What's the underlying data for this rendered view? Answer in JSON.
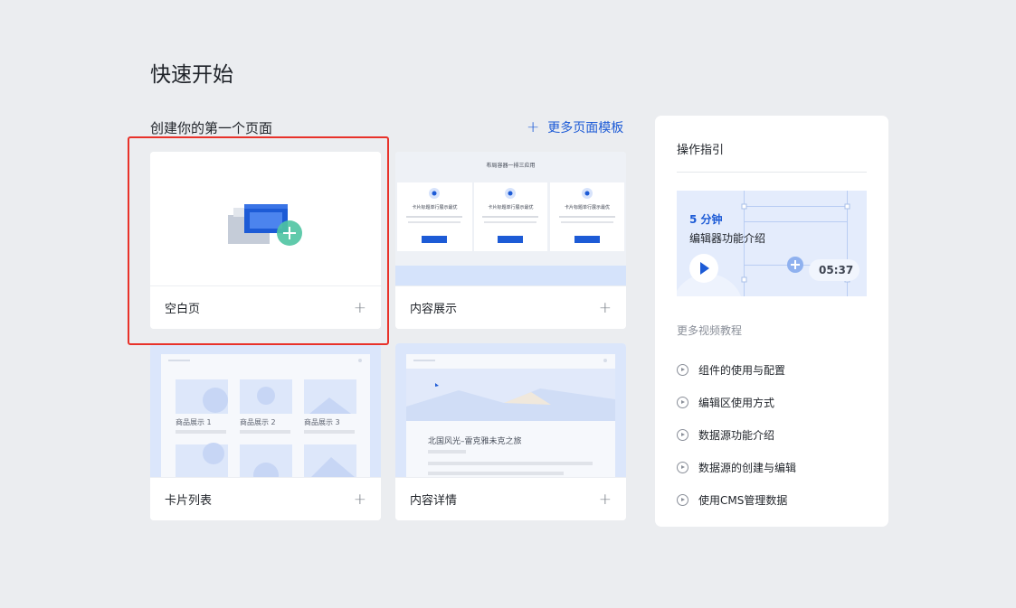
{
  "page": {
    "title": "快速开始"
  },
  "section": {
    "title": "创建你的第一个页面",
    "more_templates": "更多页面模板"
  },
  "templates": [
    {
      "label": "空白页"
    },
    {
      "label": "内容展示",
      "preview_title": "布局容器一排三应用",
      "card_title": "卡片标题单行展示最优"
    },
    {
      "label": "卡片列表",
      "items": [
        "商品展示 1",
        "商品展示 2",
        "商品展示 3"
      ]
    },
    {
      "label": "内容详情",
      "preview_title": "北国风光–雷克雅未克之旅"
    }
  ],
  "guide": {
    "title": "操作指引",
    "video": {
      "duration_label": "5 分钟",
      "subtitle": "编辑器功能介绍",
      "timestamp": "05:37"
    },
    "more_label": "更多视频教程",
    "tutorials": [
      "组件的使用与配置",
      "编辑区使用方式",
      "数据源功能介绍",
      "数据源的创建与编辑",
      "使用CMS管理数据"
    ]
  },
  "colors": {
    "accent": "#1d5bd6",
    "highlight": "#e8322a",
    "background": "#ebedf0"
  }
}
